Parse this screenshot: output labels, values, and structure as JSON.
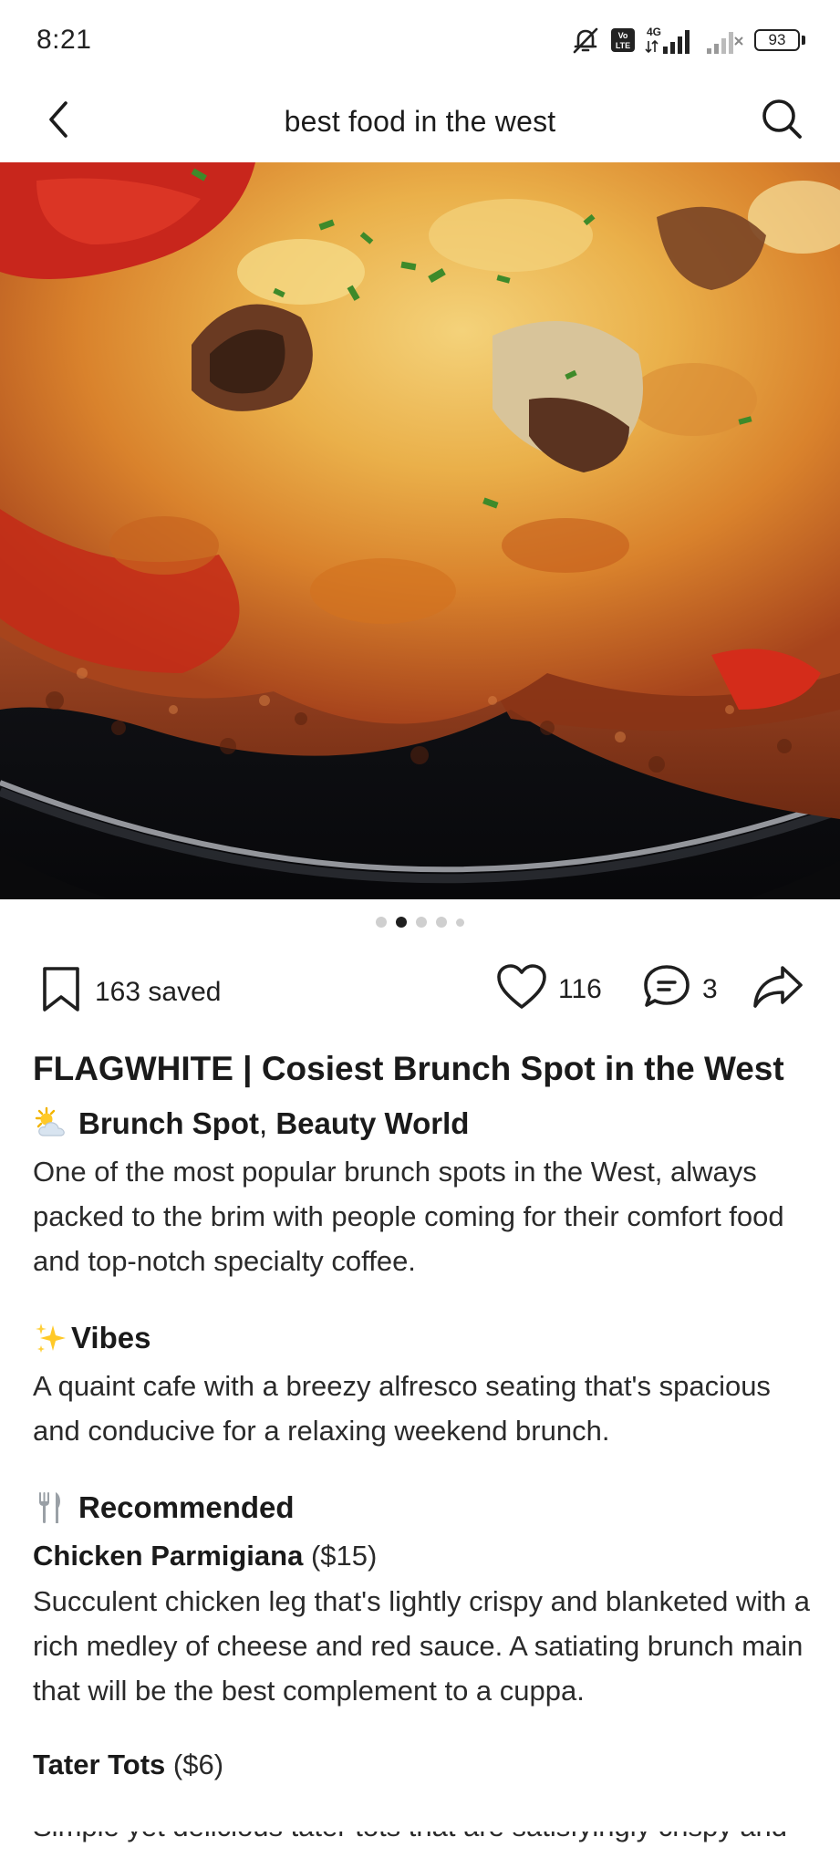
{
  "status_bar": {
    "time": "8:21",
    "battery": "93",
    "icons": [
      "bell-off-icon",
      "volte-icon",
      "signal-4g-icon",
      "signal-weak-icon",
      "battery-icon"
    ],
    "network_label": "4G",
    "volte_label": "Vo LTE"
  },
  "nav": {
    "title": "best food in the west",
    "back_icon": "chevron-left-icon",
    "search_icon": "search-icon"
  },
  "carousel": {
    "total": 5,
    "active_index": 1
  },
  "actions": {
    "saved_label": "163 saved",
    "likes": "116",
    "comments": "3"
  },
  "post": {
    "title": "FLAGWHITE | Cosiest Brunch Spot in the West",
    "location_line": {
      "emoji": "sun-behind-cloud-icon",
      "text": "Brunch Spot",
      "separator": ", ",
      "place": "Beauty World"
    },
    "intro": "One of the most popular brunch spots in the West, always packed to the brim with people coming for their comfort food and top-notch specialty coffee.",
    "vibes": {
      "emoji": "sparkles-icon",
      "heading": "Vibes",
      "text": "A quaint cafe with a breezy alfresco seating that's spacious and conducive for a relaxing weekend brunch."
    },
    "recommended": {
      "emoji": "fork-and-knife-icon",
      "heading": "Recommended",
      "items": [
        {
          "name": "Chicken Parmigiana",
          "price": "($15)",
          "description": "Succulent chicken leg that's lightly crispy and blanketed with a rich medley of cheese and red sauce. A satiating brunch main that will be the best complement to a cuppa."
        },
        {
          "name": "Tater Tots",
          "price": "($6)",
          "description": "Simple yet delicious tater tots that are satisfyingly crispy and"
        }
      ]
    }
  },
  "colors": {
    "text": "#1f1f1f",
    "dot_inactive": "#cfcfcf",
    "dot_active": "#1f1f1f",
    "image_background": "#0b0b0d"
  }
}
